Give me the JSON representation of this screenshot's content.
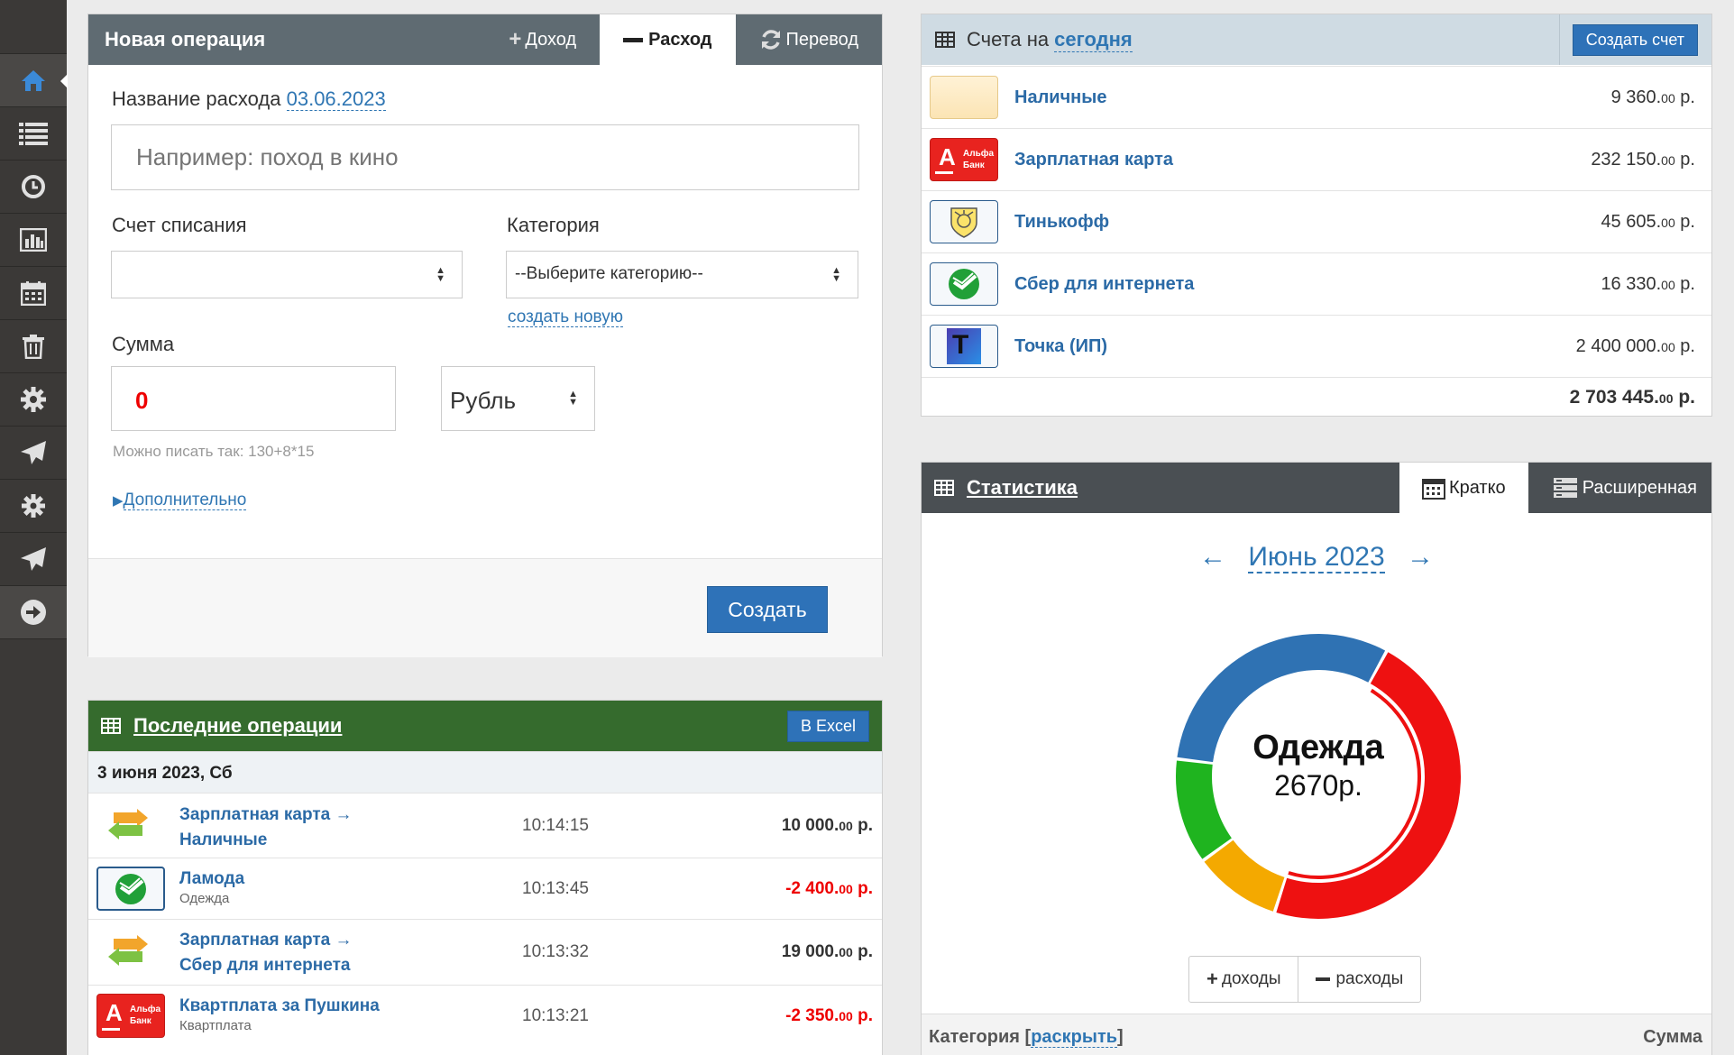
{
  "sidebar": {
    "icons": [
      "home-icon",
      "list-icon",
      "clock-icon",
      "chart-icon",
      "calendar-icon",
      "trash-icon",
      "gear-icon",
      "send-icon",
      "puzzle-icon",
      "send-icon",
      "arrow-right-icon"
    ]
  },
  "new_op": {
    "title": "Новая операция",
    "tab_income": "Доход",
    "tab_expense": "Расход",
    "tab_transfer": "Перевод",
    "name_label": "Название расхода",
    "date": "03.06.2023",
    "name_placeholder": "Например: поход в кино",
    "account_label": "Счет списания",
    "account_value": "",
    "category_label": "Категория",
    "category_value": "--Выберите категорию--",
    "create_new": "создать новую",
    "sum_label": "Сумма",
    "sum_value": "0",
    "currency": "Рубль",
    "hint": "Можно писать так: 130+8*15",
    "more": "Дополнительно",
    "submit": "Создать"
  },
  "accounts": {
    "title_prefix": "Счета на",
    "title_link": "сегодня",
    "create_button": "Создать счет",
    "items": [
      {
        "name": "Наличные",
        "amount": "9 360.",
        "cents": "00",
        "cur": " р."
      },
      {
        "name": "Зарплатная карта",
        "amount": "232 150.",
        "cents": "00",
        "cur": " р."
      },
      {
        "name": "Тинькофф",
        "amount": "45 605.",
        "cents": "00",
        "cur": " р."
      },
      {
        "name": "Сбер для интернета",
        "amount": "16 330.",
        "cents": "00",
        "cur": " р."
      },
      {
        "name": "Точка (ИП)",
        "amount": "2 400 000.",
        "cents": "00",
        "cur": " р."
      }
    ],
    "total": "2 703 445.",
    "total_cents": "00",
    "total_cur": " р.",
    "alfa_letter": "А",
    "alfa_text1": "Альфа",
    "alfa_text2": "Банк",
    "tochka_letter": "Т"
  },
  "recent": {
    "title": "Последние операции",
    "excel": "В Excel",
    "date_header": "3 июня 2023, Сб",
    "rows": [
      {
        "line1": "Зарплатная карта  →",
        "line2": "Наличные",
        "time": "10:14:15",
        "amount": "10 000.",
        "cents": "00",
        "cur": " р."
      },
      {
        "line1": "Ламода",
        "line2": "Одежда",
        "time": "10:13:45",
        "amount": "-2 400.",
        "cents": "00",
        "cur": " р."
      },
      {
        "line1": "Зарплатная карта  →",
        "line2": "Сбер для интернета",
        "time": "10:13:32",
        "amount": "19 000.",
        "cents": "00",
        "cur": " р."
      },
      {
        "line1": "Квартплата за Пушкина",
        "line2": "Квартплата",
        "time": "10:13:21",
        "amount": "-2 350.",
        "cents": "00",
        "cur": " р."
      }
    ],
    "alfa_letter": "А",
    "alfa_text1": "Альфа",
    "alfa_text2": "Банк"
  },
  "stats": {
    "title": "Статистика",
    "tab_short": "Кратко",
    "tab_extended": "Расширенная",
    "month": "Июнь 2023",
    "prev_arrow": "←",
    "next_arrow": "→",
    "center_title": "Одежда",
    "center_value": "2670р.",
    "btn_income": "доходы",
    "btn_expense": "расходы",
    "col_category": "Категория",
    "col_expand": "раскрыть",
    "col_sum": "Сумма"
  },
  "chart_data": {
    "type": "pie",
    "values": [
      47,
      10,
      12,
      31
    ],
    "colors": [
      "#ee1111",
      "#f4a900",
      "#1fb41f",
      "#2f72b3"
    ],
    "highlighted": 0
  }
}
